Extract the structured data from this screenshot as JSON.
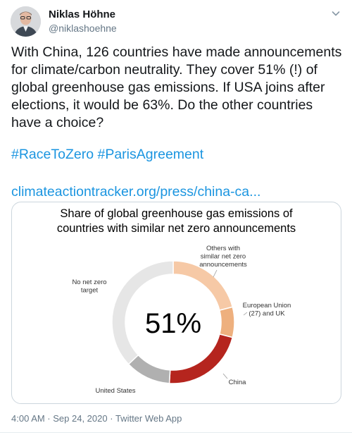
{
  "user": {
    "name": "Niklas Höhne",
    "handle": "@niklashoehne"
  },
  "tweet": {
    "text": "With China, 126 countries have made announcements for climate/carbon neutrality. They cover 51% (!) of global greenhouse gas emissions. If USA joins after elections, it would be 63%. Do the other countries have a choice?",
    "hashtags": [
      "#RaceToZero",
      "#ParisAgreement"
    ],
    "link": "climateactiontracker.org/press/china-ca...",
    "timestamp": "4:00 AM · Sep 24, 2020",
    "source": "Twitter Web App"
  },
  "icons": {
    "caret": "chevron-down-icon",
    "avatar": "avatar"
  },
  "colors": {
    "text": "#14171a",
    "secondary": "#657786",
    "link": "#1b95e0",
    "border": "#ccd6dd"
  },
  "chart_data": {
    "type": "pie",
    "title": "Share of global greenhouse gas emissions of countries with similar net zero announcements",
    "title_lines": [
      "Share of global greenhouse gas emissions of",
      "countries with similar net zero announcements"
    ],
    "center_label": "51%",
    "slices": [
      {
        "name": "Others with similar net zero announcements",
        "label_lines": [
          "Others with",
          "similar net zero",
          "announcements"
        ],
        "value": 21,
        "color": "#f6c9a6"
      },
      {
        "name": "European Union (27) and UK",
        "label_lines": [
          "European Union",
          "(27) and UK"
        ],
        "value": 8,
        "color": "#eeb07e"
      },
      {
        "name": "China",
        "label_lines": [
          "China"
        ],
        "value": 22,
        "color": "#b5251e"
      },
      {
        "name": "United States",
        "label_lines": [
          "United States"
        ],
        "value": 12,
        "color": "#b0b0b0"
      },
      {
        "name": "No net zero target",
        "label_lines": [
          "No net zero",
          "target"
        ],
        "value": 37,
        "color": "#e6e6e6"
      }
    ]
  }
}
